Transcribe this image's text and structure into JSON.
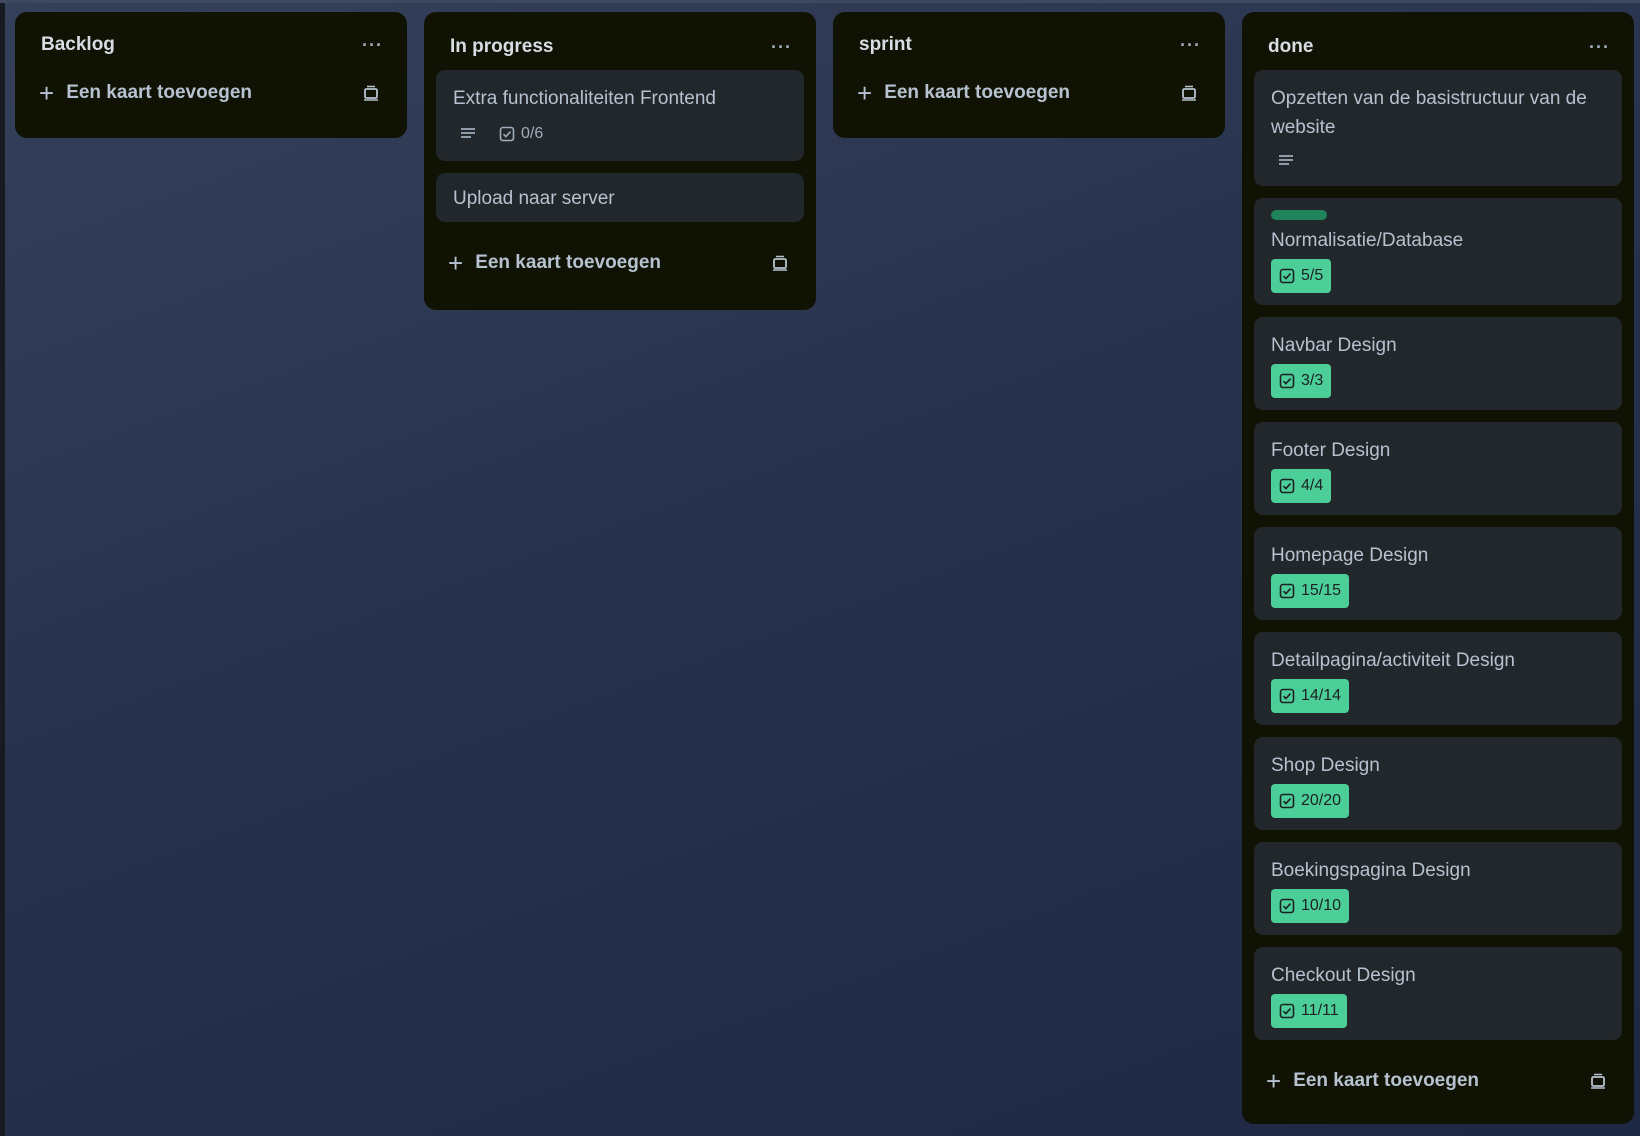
{
  "lists": [
    {
      "title": "Backlog",
      "menu": "···",
      "add_label": "Een kaart toevoegen"
    },
    {
      "title": "In progress",
      "menu": "···",
      "add_label": "Een kaart toevoegen",
      "cards": [
        {
          "title": "Extra functionaliteiten Frontend",
          "checklist": "0/6"
        },
        {
          "title": "Upload naar server"
        }
      ]
    },
    {
      "title": "sprint",
      "menu": "···",
      "add_label": "Een kaart toevoegen"
    },
    {
      "title": "done",
      "menu": "···",
      "add_label": "Een kaart toevoegen",
      "cards": [
        {
          "title": "Opzetten van de basistructuur van de website"
        },
        {
          "title": "Normalisatie/Database",
          "checklist": "5/5",
          "label_color": "#1f845a"
        },
        {
          "title": "Navbar Design",
          "checklist": "3/3"
        },
        {
          "title": "Footer Design",
          "checklist": "4/4"
        },
        {
          "title": "Homepage Design",
          "checklist": "15/15"
        },
        {
          "title": "Detailpagina/activiteit Design",
          "checklist": "14/14"
        },
        {
          "title": "Shop Design",
          "checklist": "20/20"
        },
        {
          "title": "Boekingspagina Design",
          "checklist": "10/10"
        },
        {
          "title": "Checkout Design",
          "checklist": "11/11"
        }
      ]
    }
  ],
  "icons": {
    "description": "description-icon",
    "checklist": "checklist-icon",
    "template": "card-template-icon",
    "add": "plus-icon"
  },
  "colors": {
    "list_bg": "#101204",
    "card_bg": "#22272b",
    "complete_badge": "#4bce97",
    "label_green": "#1f845a"
  }
}
